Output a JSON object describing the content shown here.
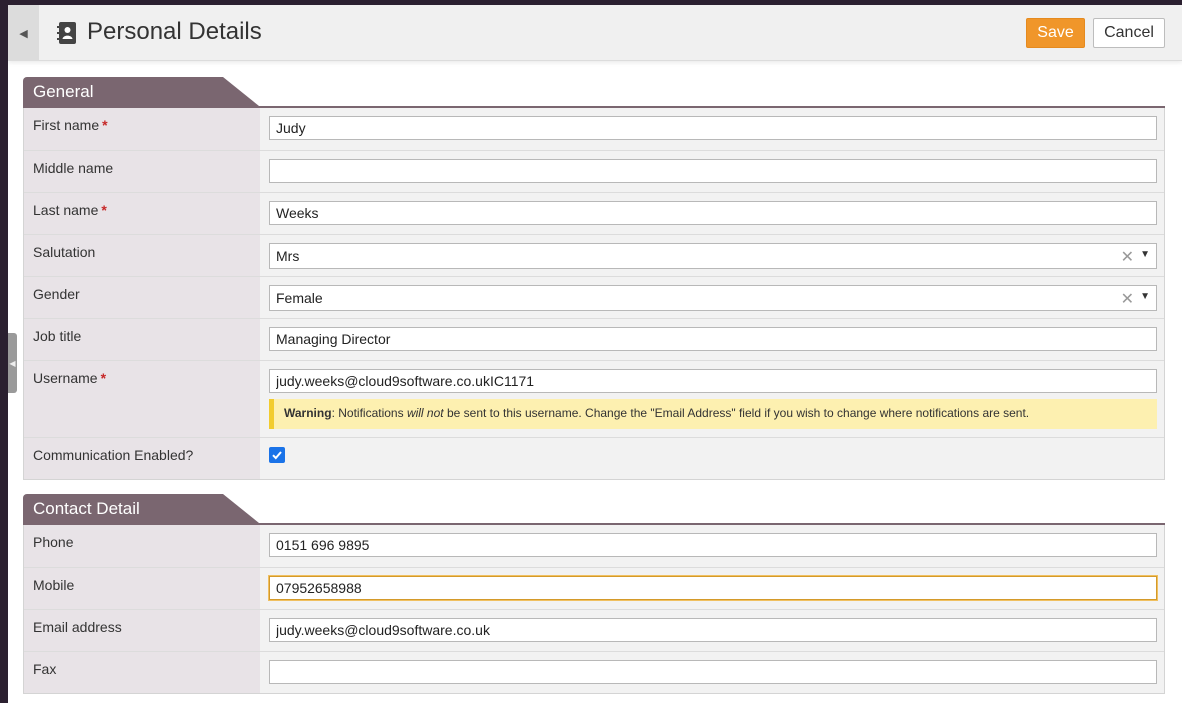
{
  "header": {
    "title": "Personal Details",
    "save_label": "Save",
    "cancel_label": "Cancel"
  },
  "sections": {
    "general": {
      "title": "General",
      "first_name": {
        "label": "First name",
        "required": "*",
        "value": "Judy"
      },
      "middle_name": {
        "label": "Middle name",
        "value": ""
      },
      "last_name": {
        "label": "Last name",
        "required": "*",
        "value": "Weeks"
      },
      "salutation": {
        "label": "Salutation",
        "value": "Mrs"
      },
      "gender": {
        "label": "Gender",
        "value": "Female"
      },
      "job_title": {
        "label": "Job title",
        "value": "Managing Director"
      },
      "username": {
        "label": "Username",
        "required": "*",
        "value": "judy.weeks@cloud9software.co.ukIC1171",
        "warning": {
          "strong": "Warning",
          "part1": ": Notifications ",
          "emphasis": "will not",
          "part2": " be sent to this username. Change the \"Email Address\" field if you wish to change where notifications are sent."
        }
      },
      "communication_enabled": {
        "label": "Communication Enabled?",
        "checked": true
      }
    },
    "contact": {
      "title": "Contact Detail",
      "phone": {
        "label": "Phone",
        "value": "0151 696 9895"
      },
      "mobile": {
        "label": "Mobile",
        "value": "07952658988"
      },
      "email": {
        "label": "Email address",
        "value": "judy.weeks@cloud9software.co.uk"
      },
      "fax": {
        "label": "Fax",
        "value": ""
      }
    }
  },
  "colors": {
    "accent": "#f0962a",
    "section_tab": "#7a6670",
    "label_bg": "#e8e3e7",
    "warning_bg": "#fdf0b0",
    "checkbox": "#1a73e8"
  },
  "icons": {
    "collapse": "triangle-left-icon",
    "title": "contact-book-icon",
    "clear": "close-icon",
    "dropdown": "chevron-down-icon",
    "check": "check-icon"
  }
}
